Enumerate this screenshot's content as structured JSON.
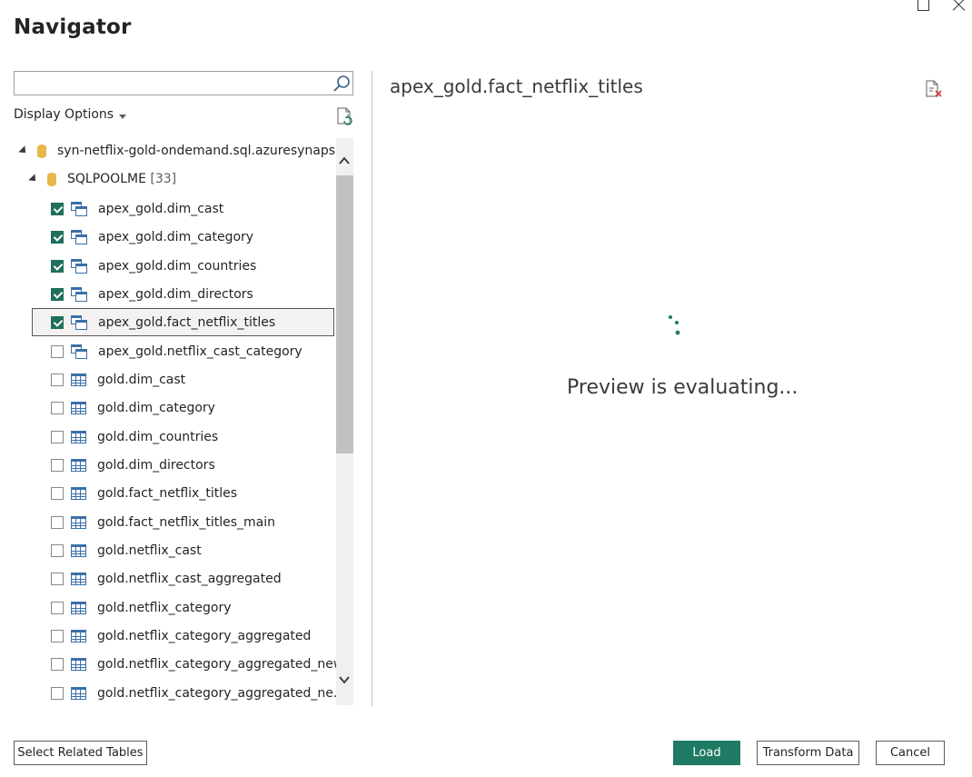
{
  "window": {
    "title": "Navigator"
  },
  "search": {
    "value": "",
    "placeholder": ""
  },
  "display_options_label": "Display Options",
  "tree": {
    "server": "syn-netflix-gold-ondemand.sql.azuresynaps...",
    "database": "SQLPOOLME",
    "database_count": "[33]",
    "items": [
      {
        "label": "apex_gold.dim_cast",
        "checked": true,
        "type": "view",
        "selected": false
      },
      {
        "label": "apex_gold.dim_category",
        "checked": true,
        "type": "view",
        "selected": false
      },
      {
        "label": "apex_gold.dim_countries",
        "checked": true,
        "type": "view",
        "selected": false
      },
      {
        "label": "apex_gold.dim_directors",
        "checked": true,
        "type": "view",
        "selected": false
      },
      {
        "label": "apex_gold.fact_netflix_titles",
        "checked": true,
        "type": "view",
        "selected": true
      },
      {
        "label": "apex_gold.netflix_cast_category",
        "checked": false,
        "type": "view",
        "selected": false
      },
      {
        "label": "gold.dim_cast",
        "checked": false,
        "type": "table",
        "selected": false
      },
      {
        "label": "gold.dim_category",
        "checked": false,
        "type": "table",
        "selected": false
      },
      {
        "label": "gold.dim_countries",
        "checked": false,
        "type": "table",
        "selected": false
      },
      {
        "label": "gold.dim_directors",
        "checked": false,
        "type": "table",
        "selected": false
      },
      {
        "label": "gold.fact_netflix_titles",
        "checked": false,
        "type": "table",
        "selected": false
      },
      {
        "label": "gold.fact_netflix_titles_main",
        "checked": false,
        "type": "table",
        "selected": false
      },
      {
        "label": "gold.netflix_cast",
        "checked": false,
        "type": "table",
        "selected": false
      },
      {
        "label": "gold.netflix_cast_aggregated",
        "checked": false,
        "type": "table",
        "selected": false
      },
      {
        "label": "gold.netflix_category",
        "checked": false,
        "type": "table",
        "selected": false
      },
      {
        "label": "gold.netflix_category_aggregated",
        "checked": false,
        "type": "table",
        "selected": false
      },
      {
        "label": "gold.netflix_category_aggregated_new",
        "checked": false,
        "type": "table",
        "selected": false
      },
      {
        "label": "gold.netflix_category_aggregated_ne...",
        "checked": false,
        "type": "table",
        "selected": false
      }
    ]
  },
  "preview": {
    "title": "apex_gold.fact_netflix_titles",
    "status": "Preview is evaluating..."
  },
  "buttons": {
    "select_related": "Select Related Tables",
    "load": "Load",
    "transform": "Transform Data",
    "cancel": "Cancel"
  },
  "colors": {
    "accent": "#1f7a63",
    "checkbox": "#1f6f5c",
    "database_icon": "#e8b84a"
  }
}
